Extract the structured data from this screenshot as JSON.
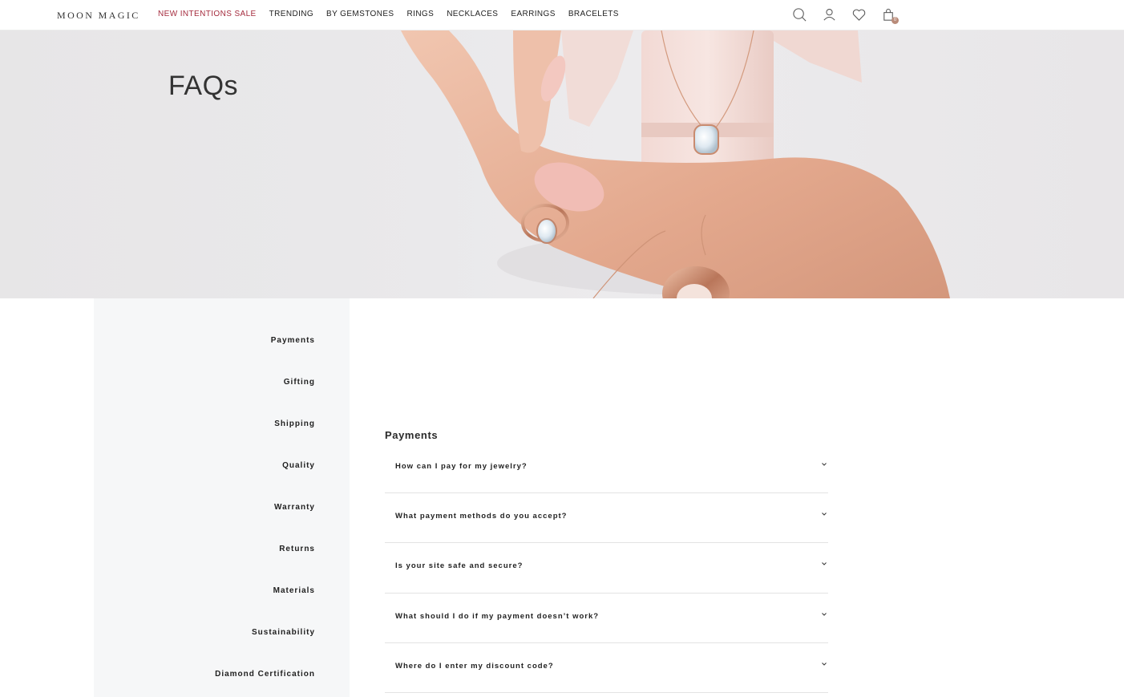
{
  "header": {
    "logo": "MOON MAGIC",
    "nav": [
      {
        "label": "NEW INTENTIONS SALE",
        "highlight": true
      },
      {
        "label": "TRENDING"
      },
      {
        "label": "BY GEMSTONES"
      },
      {
        "label": "RINGS"
      },
      {
        "label": "NECKLACES"
      },
      {
        "label": "EARRINGS"
      },
      {
        "label": "BRACELETS"
      }
    ],
    "icons": [
      "search-icon",
      "account-icon",
      "wishlist-heart-icon",
      "cart-bag-icon"
    ],
    "cart_count": "0"
  },
  "hero": {
    "title": "FAQs"
  },
  "sidebar": {
    "items": [
      {
        "label": "Payments"
      },
      {
        "label": "Gifting"
      },
      {
        "label": "Shipping"
      },
      {
        "label": "Quality"
      },
      {
        "label": "Warranty"
      },
      {
        "label": "Returns"
      },
      {
        "label": "Materials"
      },
      {
        "label": "Sustainability"
      },
      {
        "label": "Diamond Certification"
      }
    ]
  },
  "faq": {
    "heading": "Payments",
    "questions": [
      {
        "q": "How can I pay for my jewelry?"
      },
      {
        "q": "What payment methods do you accept?"
      },
      {
        "q": "Is your site safe and secure?"
      },
      {
        "q": "What should I do if my payment doesn’t work?"
      },
      {
        "q": "Where do I enter my discount code?"
      }
    ]
  },
  "colors": {
    "sale_accent": "#a52c3e",
    "sidebar_bg": "#f6f7f8",
    "divider": "#e3e3e3"
  }
}
